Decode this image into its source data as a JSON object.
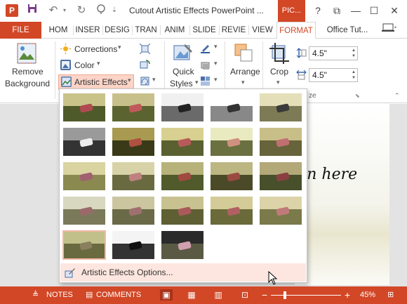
{
  "titlebar": {
    "app_letter": "P",
    "window_title": "Cutout Artistic Effects PowerPoint ...",
    "contextual_tab": "PIC...",
    "qat": [
      "save-icon",
      "undo-icon",
      "redo-icon",
      "present-icon"
    ],
    "window_buttons": {
      "help": "?",
      "restore": "⧉",
      "minimize": "—",
      "maximize": "☐",
      "close": "✕"
    }
  },
  "tabs": [
    "FILE",
    "HOM",
    "INSER",
    "DESIG",
    "TRAN",
    "ANIM",
    "SLIDE",
    "REVIE",
    "VIEW",
    "FORMAT",
    "Office Tut..."
  ],
  "ribbon": {
    "remove_background": {
      "line1": "Remove",
      "line2": "Background"
    },
    "adjust": {
      "corrections": "Corrections",
      "color": "Color",
      "artistic_effects": "Artistic Effects"
    },
    "quick_styles": {
      "line1": "Quick",
      "line2": "Styles"
    },
    "arrange": "Arrange",
    "crop": "Crop",
    "size": {
      "height": "4.5\"",
      "width": "4.5\"",
      "group_label": "ze"
    },
    "dropdown_arrow": "▾"
  },
  "gallery": {
    "thumbnails": [
      {
        "style": "normal"
      },
      {
        "style": "marker"
      },
      {
        "style": "pencil-grayscale"
      },
      {
        "style": "pencil-sketch"
      },
      {
        "style": "line-drawing"
      },
      {
        "style": "chalk"
      },
      {
        "style": "paint-strokes"
      },
      {
        "style": "paint-brush"
      },
      {
        "style": "glow-diffused"
      },
      {
        "style": "blur"
      },
      {
        "style": "light-screen"
      },
      {
        "style": "watercolor"
      },
      {
        "style": "cutout"
      },
      {
        "style": "mosaic"
      },
      {
        "style": "film-grain"
      },
      {
        "style": "glass"
      },
      {
        "style": "cement"
      },
      {
        "style": "texturizer"
      },
      {
        "style": "crisscross"
      },
      {
        "style": "pastels"
      },
      {
        "style": "plastic-wrap",
        "selected": true
      },
      {
        "style": "photocopy"
      },
      {
        "style": "glow-edges"
      }
    ],
    "options_label": "Artistic Effects Options..."
  },
  "slide": {
    "visible_text": "on here"
  },
  "statusbar": {
    "notes": "NOTES",
    "comments": "COMMENTS",
    "zoom_minus": "−",
    "zoom_plus": "+",
    "zoom": "45%",
    "zoom_fraction": 0.45
  },
  "colors": {
    "accent": "#d24726",
    "accent_dark": "#a8321a",
    "hover": "#fcd4c8"
  }
}
